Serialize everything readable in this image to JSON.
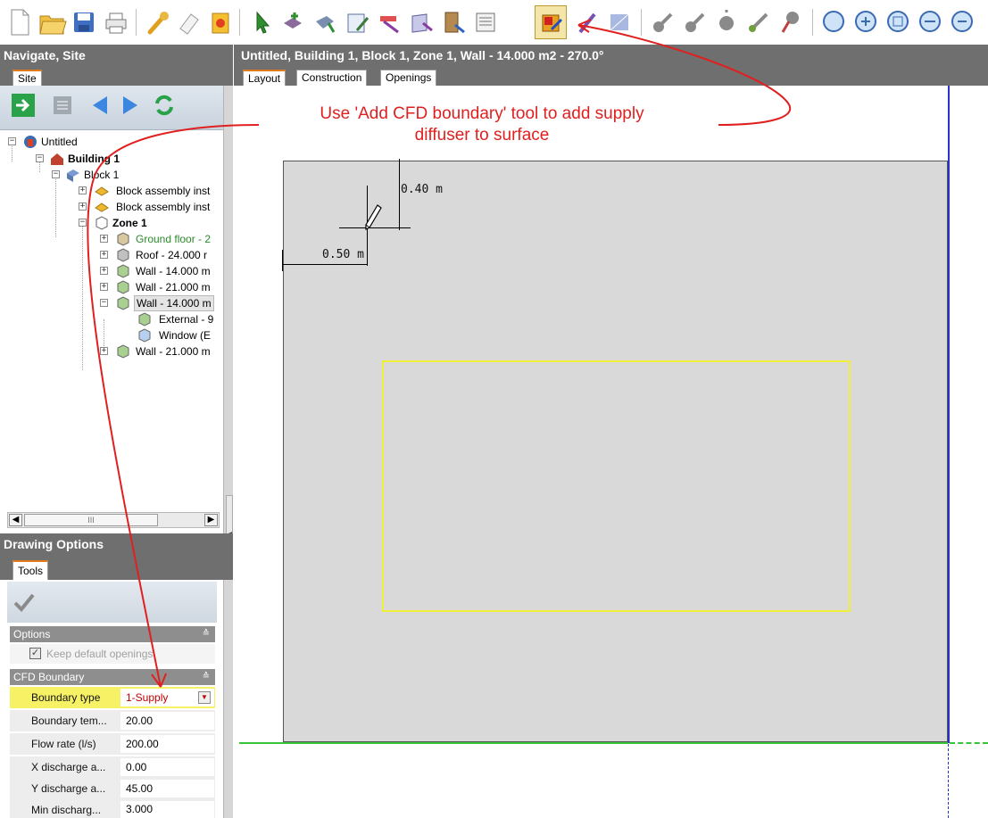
{
  "toolbar": {
    "icons": [
      "new-file-icon",
      "open-folder-icon",
      "save-icon",
      "print-icon",
      "wrench-icon",
      "eraser-icon",
      "import-icon",
      "pointer-icon",
      "add-block-icon",
      "draw-block-icon",
      "draw-partition-icon",
      "cut-icon",
      "add-window-icon",
      "add-door-icon",
      "add-vent-icon",
      "add-cfd-boundary-icon",
      "draw-line-icon",
      "hatch-icon",
      "add-component-icon",
      "move-icon",
      "rotate-icon",
      "stretch-icon",
      "pin-icon",
      "zoom-window-icon",
      "zoom-in-icon",
      "zoom-extents-icon",
      "zoom-pan-icon",
      "zoom-out-icon"
    ],
    "active": "add-cfd-boundary-icon"
  },
  "left": {
    "header": "Navigate, Site",
    "tab": "Site",
    "tree": [
      {
        "label": "Untitled",
        "level": 0
      },
      {
        "label": "Building 1",
        "level": 1,
        "bold": true
      },
      {
        "label": "Block 1",
        "level": 2
      },
      {
        "label": "Block assembly inst",
        "level": 3
      },
      {
        "label": "Block assembly inst",
        "level": 3
      },
      {
        "label": "Zone 1",
        "level": 3,
        "bold": true
      },
      {
        "label": "Ground floor - 2",
        "level": 4,
        "green": true
      },
      {
        "label": "Roof - 24.000 r",
        "level": 4
      },
      {
        "label": "Wall - 14.000 m",
        "level": 4
      },
      {
        "label": "Wall - 21.000 m",
        "level": 4
      },
      {
        "label": "Wall - 14.000 m",
        "level": 4,
        "selected": true
      },
      {
        "label": "External - 9",
        "level": 5
      },
      {
        "label": "Window (E",
        "level": 5
      },
      {
        "label": "Wall - 21.000 m",
        "level": 4
      }
    ],
    "scroll_thumb": "III"
  },
  "drawing": {
    "header": "Drawing Options",
    "tab": "Tools",
    "options_group": "Options",
    "keep_default": "Keep default openings",
    "cfd_group": "CFD Boundary",
    "props": [
      {
        "name": "Boundary type",
        "value": "1-Supply",
        "dropdown": true
      },
      {
        "name": "Boundary tem...",
        "value": "20.00"
      },
      {
        "name": "Flow rate (l/s)",
        "value": "200.00"
      },
      {
        "name": "X discharge a...",
        "value": "0.00"
      },
      {
        "name": "Y discharge a...",
        "value": "45.00"
      },
      {
        "name": "Min discharg...",
        "value": "3.000"
      }
    ]
  },
  "right": {
    "header": "Untitled, Building 1, Block 1, Zone 1, Wall - 14.000 m2 - 270.0°",
    "tabs": [
      "Layout",
      "Construction",
      "Openings"
    ]
  },
  "canvas": {
    "dim_vertical": "0.40 m",
    "dim_horizontal": "0.50 m"
  },
  "annotation": {
    "line1": "Use 'Add CFD boundary' tool to add supply",
    "line2": "diffuser to surface",
    "color": "#e02020"
  }
}
